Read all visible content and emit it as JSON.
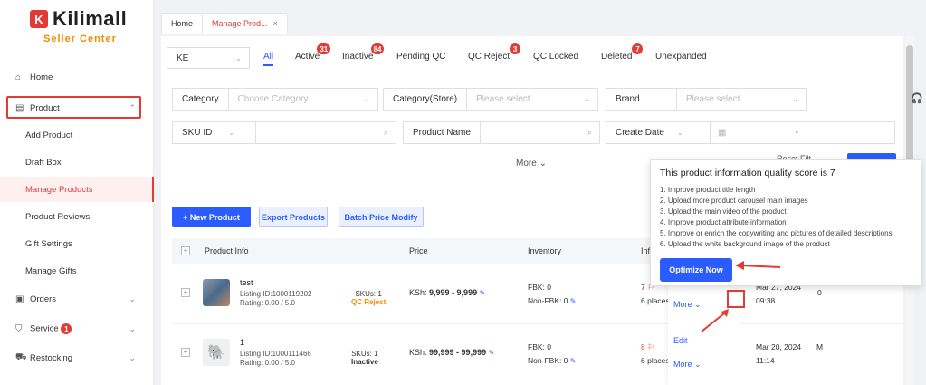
{
  "brand": {
    "badge": "K",
    "name": "Kilimall",
    "subtitle": "Seller Center"
  },
  "sidebar": {
    "home": "Home",
    "product": "Product",
    "sub": [
      "Add Product",
      "Draft Box",
      "Manage Products",
      "Product Reviews",
      "Gift Settings",
      "Manage Gifts"
    ],
    "orders": "Orders",
    "service": "Service",
    "service_badge": "1",
    "restocking": "Restocking"
  },
  "tabs": {
    "home": "Home",
    "active": "Manage Prod...",
    "close": "×"
  },
  "store": {
    "value": "KE"
  },
  "status_tabs": [
    {
      "label": "All",
      "badge": ""
    },
    {
      "label": "Active",
      "badge": "31"
    },
    {
      "label": "Inactive",
      "badge": "84"
    },
    {
      "label": "Pending QC",
      "badge": ""
    },
    {
      "label": "QC Reject",
      "badge": "3"
    },
    {
      "label": "QC Locked",
      "badge": ""
    },
    {
      "label": "Deleted",
      "badge": "7"
    },
    {
      "label": "Unexpanded",
      "badge": ""
    }
  ],
  "filters": {
    "category": {
      "label": "Category",
      "placeholder": "Choose Category"
    },
    "category_store": {
      "label": "Category(Store)",
      "placeholder": "Please select"
    },
    "brand": {
      "label": "Brand",
      "placeholder": "Please select"
    },
    "sku": {
      "label": "SKU ID"
    },
    "product_name": {
      "label": "Product Name"
    },
    "create_date": {
      "label": "Create Date",
      "sep": "-"
    },
    "more": "More",
    "reset": "Reset Filt",
    "search": "Search"
  },
  "actions": {
    "new_product": "+ New Product",
    "export": "Export Products",
    "batch": "Batch Price Modify"
  },
  "table": {
    "headers": [
      "Product Info",
      "Price",
      "Inventory",
      "Info"
    ],
    "rows": [
      {
        "name": "test",
        "listing": "Listing ID:1000119202",
        "rating": "Rating: 0.00 / 5.0",
        "skus": "SKUs: 1",
        "status": "QC Reject",
        "price_prefix": "KSh:",
        "price": "9,999 - 9,999",
        "fbk": "FBK: 0",
        "nonfbk": "Non-FBK: 0",
        "score": "7",
        "optimize": "6 places to be optimized",
        "date": "Mar 27, 2024",
        "time": "09:38",
        "extra": "0",
        "more": "More"
      },
      {
        "name": "1",
        "listing": "Listing ID:1000111466",
        "rating": "Rating: 0.00 / 5.0",
        "skus": "SKUs: 1",
        "status": "Inactive",
        "price_prefix": "KSh:",
        "price": "99,999 - 99,999",
        "fbk": "FBK: 0",
        "nonfbk": "Non-FBK: 0",
        "score": "8",
        "optimize": "6 places to be optimized",
        "date": "Mar 20, 2024",
        "time": "11:14",
        "extra": "M",
        "edit": "Edit",
        "more": "More"
      }
    ]
  },
  "popover": {
    "title": "This product information quality score is 7",
    "items": [
      "1. Improve product title length",
      "2. Upload more product carousel main images",
      "3. Upload the main video of the product",
      "4. Improve product attribute information",
      "5. Improve or enrich the copywriting and pictures of detailed descriptions",
      "6. Upload the white background image of the product"
    ],
    "button": "Optimize Now"
  },
  "colors": {
    "brand_red": "#e53935",
    "primary_blue": "#2b5cff",
    "seller_orange": "#f08c00"
  }
}
